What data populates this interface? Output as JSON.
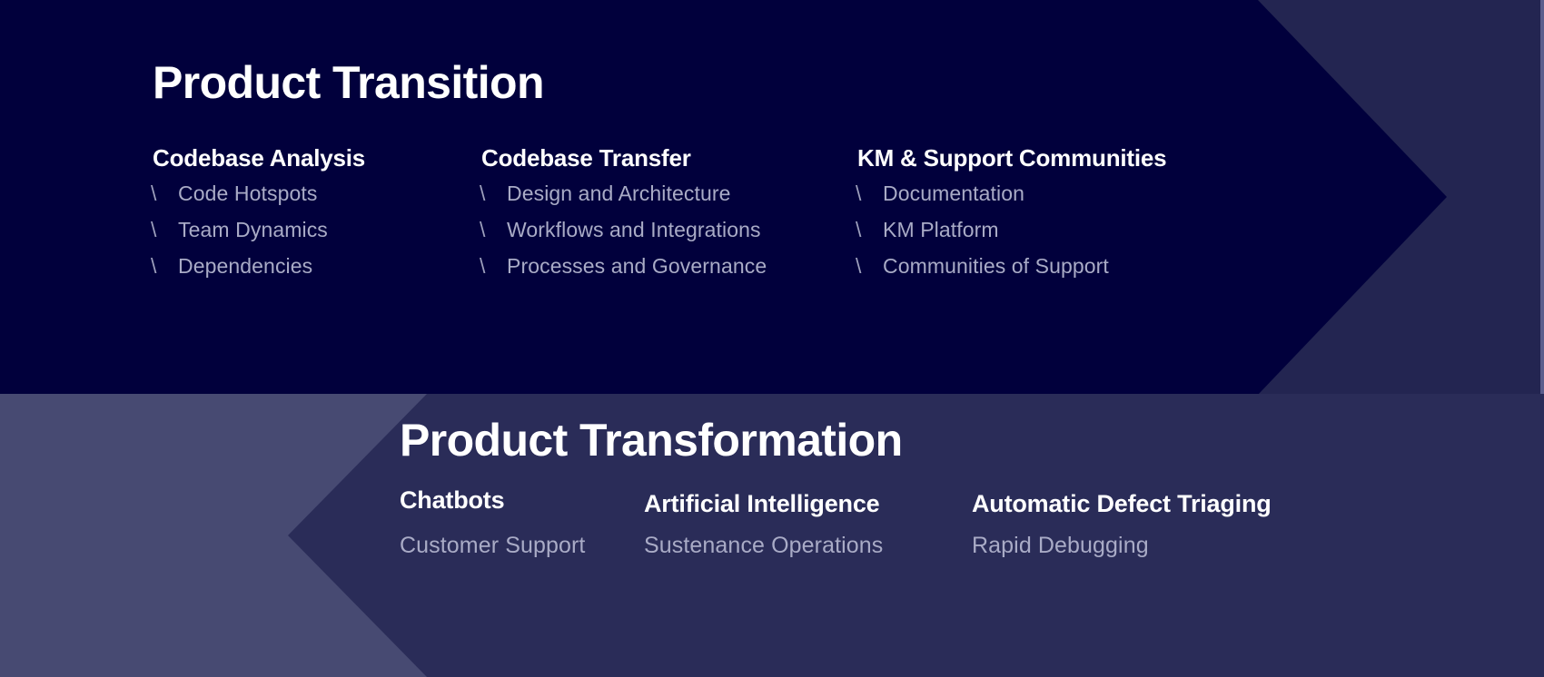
{
  "colors": {
    "background": "#232551",
    "transition_band": "#01003c",
    "transformation_light": "#474a72",
    "transformation_dark": "#2a2c58",
    "heading_text": "#ffffff",
    "body_text": "#a9abc6",
    "edge_strip": "#5b5e8c"
  },
  "transition": {
    "title": "Product Transition",
    "columns": [
      {
        "heading": "Codebase Analysis",
        "items": [
          {
            "mark": "\\",
            "label": "Code Hotspots"
          },
          {
            "mark": "\\",
            "label": "Team Dynamics"
          },
          {
            "mark": "\\",
            "label": "Dependencies"
          }
        ]
      },
      {
        "heading": "Codebase Transfer",
        "items": [
          {
            "mark": "\\",
            "label": "Design and Architecture"
          },
          {
            "mark": "\\",
            "label": "Workflows and Integrations"
          },
          {
            "mark": "\\",
            "label": "Processes and Governance"
          }
        ]
      },
      {
        "heading": "KM & Support Communities",
        "items": [
          {
            "mark": "\\",
            "label": "Documentation"
          },
          {
            "mark": "\\",
            "label": "KM Platform"
          },
          {
            "mark": "\\",
            "label": "Communities of Support"
          }
        ]
      }
    ]
  },
  "transformation": {
    "title": "Product Transformation",
    "columns": [
      {
        "heading": "Chatbots",
        "caption": "Customer Support"
      },
      {
        "heading": "Artificial Intelligence",
        "caption": "Sustenance Operations"
      },
      {
        "heading": "Automatic Defect Triaging",
        "caption": "Rapid Debugging"
      }
    ]
  }
}
